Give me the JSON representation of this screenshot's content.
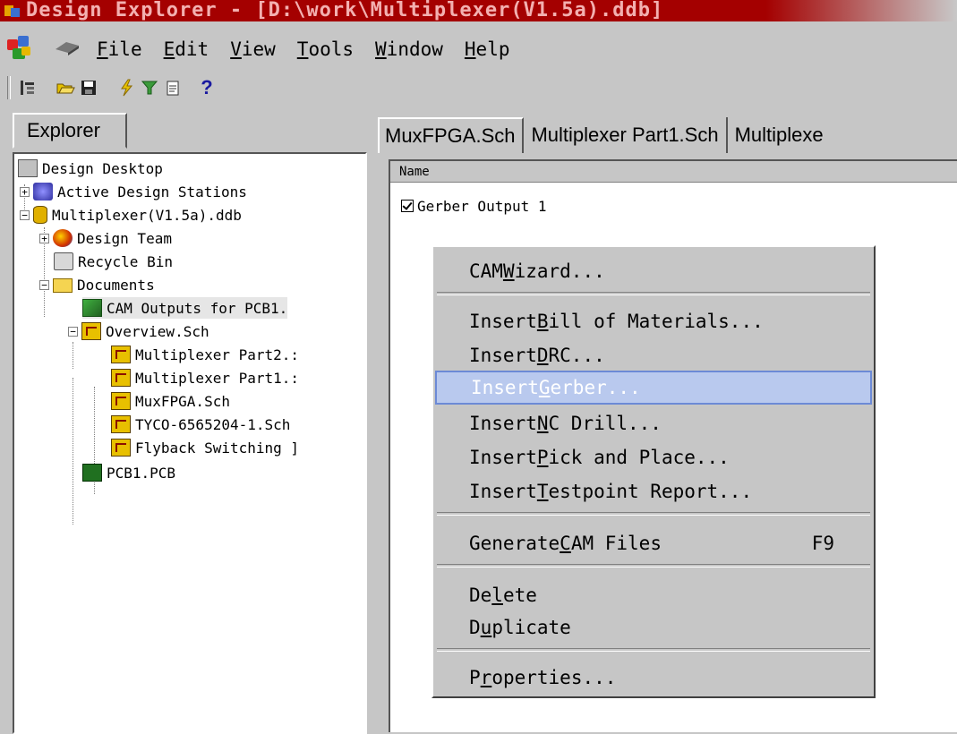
{
  "window": {
    "title": "Design Explorer - [D:\\work\\Multiplexer(V1.5a).ddb]"
  },
  "menubar": {
    "items": [
      {
        "label": "File",
        "underline": "F",
        "rest": "ile"
      },
      {
        "label": "Edit",
        "underline": "E",
        "rest": "dit"
      },
      {
        "label": "View",
        "underline": "V",
        "rest": "iew"
      },
      {
        "label": "Tools",
        "underline": "T",
        "rest": "ools"
      },
      {
        "label": "Window",
        "underline": "W",
        "rest": "indow"
      },
      {
        "label": "Help",
        "underline": "H",
        "rest": "elp"
      }
    ]
  },
  "toolbar": {
    "buttons": [
      "explorer-toggle-icon",
      "open-folder-icon",
      "save-icon",
      "lightning-icon",
      "filter-icon",
      "new-doc-icon",
      "help-icon"
    ],
    "help_label": "?"
  },
  "explorer": {
    "tab_label": "Explorer",
    "tree": [
      {
        "label": "Design Desktop"
      },
      {
        "label": "Active Design Stations"
      },
      {
        "label": "Multiplexer(V1.5a).ddb"
      },
      {
        "label": "Design Team"
      },
      {
        "label": "Recycle Bin"
      },
      {
        "label": "Documents"
      },
      {
        "label": "CAM Outputs for PCB1."
      },
      {
        "label": "Overview.Sch"
      },
      {
        "label": "Multiplexer Part2.:"
      },
      {
        "label": "Multiplexer Part1.:"
      },
      {
        "label": "MuxFPGA.Sch"
      },
      {
        "label": "TYCO-6565204-1.Sch"
      },
      {
        "label": "Flyback Switching ]"
      },
      {
        "label": "PCB1.PCB"
      }
    ]
  },
  "documents": {
    "tabs": [
      {
        "label": "MuxFPGA.Sch"
      },
      {
        "label": "Multiplexer Part1.Sch"
      },
      {
        "label": "Multiplexe"
      }
    ],
    "column_header": "Name",
    "items": [
      {
        "label": "Gerber Output 1",
        "checked": true
      }
    ]
  },
  "context_menu": {
    "items": [
      {
        "pre": "CAM ",
        "u": "W",
        "post": "izard...",
        "shortcut": ""
      },
      {
        "pre": "Insert ",
        "u": "B",
        "post": "ill of Materials...",
        "shortcut": ""
      },
      {
        "pre": "Insert ",
        "u": "D",
        "post": "RC...",
        "shortcut": ""
      },
      {
        "pre": "Insert ",
        "u": "G",
        "post": "erber...",
        "shortcut": ""
      },
      {
        "pre": "Insert ",
        "u": "N",
        "post": "C Drill...",
        "shortcut": ""
      },
      {
        "pre": "Insert ",
        "u": "P",
        "post": "ick and Place...",
        "shortcut": ""
      },
      {
        "pre": "Insert ",
        "u": "T",
        "post": "estpoint Report...",
        "shortcut": ""
      },
      {
        "pre": "Generate ",
        "u": "C",
        "post": "AM Files",
        "shortcut": "F9"
      },
      {
        "pre": "De",
        "u": "l",
        "post": "ete",
        "shortcut": ""
      },
      {
        "pre": "D",
        "u": "u",
        "post": "plicate",
        "shortcut": ""
      },
      {
        "pre": "P",
        "u": "r",
        "post": "operties...",
        "shortcut": ""
      }
    ]
  },
  "colors": {
    "titlebar": "#a40000",
    "face": "#c6c6c6",
    "highlight": "#b9c9ee"
  }
}
